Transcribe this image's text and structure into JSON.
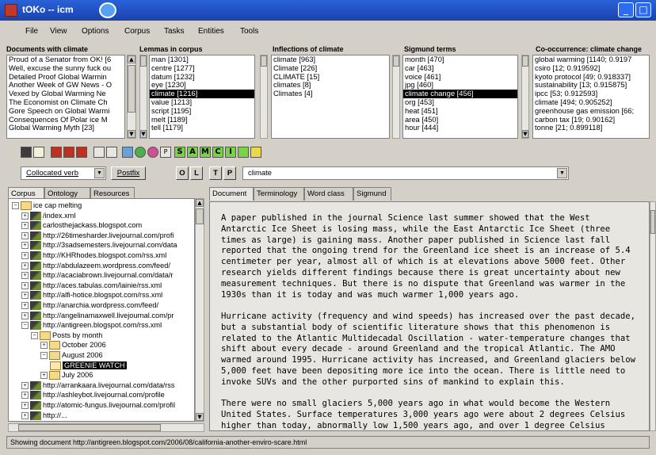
{
  "window": {
    "title": "tOKo -- icm"
  },
  "menu": [
    "File",
    "View",
    "Options",
    "Corpus",
    "Tasks",
    "Entities",
    "Tools"
  ],
  "panels": {
    "documents": {
      "title": "Documents with climate",
      "items": [
        "Proud of a Senator from OK! [6",
        "Well, excuse the sunny fuck ou",
        "Detailed Proof Global Warmin",
        "Another Week of GW News - O",
        "Vexed by Global Warming Ne",
        "The Economist on Climate Ch",
        "Gore Speech on Global Warmi",
        "Consequences Of Polar ice M",
        "Global Warming Myth [23]"
      ]
    },
    "lemmas": {
      "title": "Lemmas in corpus",
      "items": [
        "man [1301]",
        "centre [1277]",
        "datum [1232]",
        "eye [1230]",
        "climate [1216]",
        "value [1213]",
        "script [1195]",
        "melt [1189]",
        "tell [1179]"
      ],
      "selected": 4
    },
    "inflections": {
      "title": "Inflections of climate",
      "items": [
        "climate [963]",
        "Climate [226]",
        "CLIMATE [15]",
        "climates [8]",
        "Climates [4]"
      ]
    },
    "sigmund": {
      "title": "Sigmund terms",
      "items": [
        "month [470]",
        "car [463]",
        "voice [461]",
        "jpg [460]",
        "climate change [456]",
        "org [453]",
        "heat [451]",
        "area [450]",
        "hour [444]"
      ],
      "selected": 4
    },
    "cooccurrence": {
      "title": "Co-occurrence: climate change",
      "items": [
        "global warming [1140; 0.9197",
        "csiro [12; 0.919592]",
        "kyoto protocol [49; 0.918337]",
        "sustainability [13; 0.915875]",
        "ipcc [53; 0.912593]",
        "climate [494; 0.905252]",
        "greenhouse gas emission [66;",
        "carbon tax [19; 0.90162]",
        "tonne [21; 0.899118]"
      ]
    }
  },
  "toolbar": {
    "letters": [
      "P",
      "S",
      "A",
      "M",
      "C",
      "I"
    ]
  },
  "controls": {
    "collocated": "Collocated verb",
    "postfix": "Postfix",
    "o": "O",
    "l": "L",
    "t": "T",
    "p": "P",
    "search_value": "climate"
  },
  "left_tabs": [
    "Corpus",
    "Ontology",
    "Resources"
  ],
  "right_tabs": [
    "Document",
    "Terminology",
    "Word class",
    "Sigmund"
  ],
  "tree": [
    {
      "label": "ice cap melting",
      "indent": 0,
      "glyph": "−",
      "icon": "folder"
    },
    {
      "label": "/index.xml",
      "indent": 1,
      "glyph": "+",
      "icon": "feed"
    },
    {
      "label": "carlosthejackass.blogspot.com",
      "indent": 1,
      "glyph": "+",
      "icon": "feed"
    },
    {
      "label": "http://26timesharder.livejournal.com/profi",
      "indent": 1,
      "glyph": "+",
      "icon": "feed"
    },
    {
      "label": "http://3sadsemesters.livejournal.com/data",
      "indent": 1,
      "glyph": "+",
      "icon": "feed"
    },
    {
      "label": "http://KHRhodes.blogspot.com/rss.xml",
      "indent": 1,
      "glyph": "+",
      "icon": "feed"
    },
    {
      "label": "http://abdulazeem.wordpress.com/feed/",
      "indent": 1,
      "glyph": "+",
      "icon": "feed"
    },
    {
      "label": "http://acaciabrown.livejournal.com/data/r",
      "indent": 1,
      "glyph": "+",
      "icon": "feed"
    },
    {
      "label": "http://aces.tabulas.com/lainie/rss.xml",
      "indent": 1,
      "glyph": "+",
      "icon": "feed"
    },
    {
      "label": "http://alfi-hotice.blogspot.com/rss.xml",
      "indent": 1,
      "glyph": "+",
      "icon": "feed"
    },
    {
      "label": "http://anarchia.wordpress.com/feed/",
      "indent": 1,
      "glyph": "+",
      "icon": "feed"
    },
    {
      "label": "http://angelinamaxwell.livejournal.com/pr",
      "indent": 1,
      "glyph": "+",
      "icon": "feed"
    },
    {
      "label": "http://antigreen.blogspot.com/rss.xml",
      "indent": 1,
      "glyph": "−",
      "icon": "feed"
    },
    {
      "label": "Posts by month",
      "indent": 2,
      "glyph": "−",
      "icon": "folder"
    },
    {
      "label": "October 2006",
      "indent": 3,
      "glyph": "+",
      "icon": "folder"
    },
    {
      "label": "August 2006",
      "indent": 3,
      "glyph": "−",
      "icon": "folder"
    },
    {
      "label": "GREENIE WATCH",
      "indent": 4,
      "glyph": "",
      "icon": "mail",
      "selected": true
    },
    {
      "label": "July 2006",
      "indent": 3,
      "glyph": "+",
      "icon": "folder"
    },
    {
      "label": "http://arrankaara.livejournal.com/data/rss",
      "indent": 1,
      "glyph": "+",
      "icon": "feed"
    },
    {
      "label": "http://ashleybot.livejournal.com/profile",
      "indent": 1,
      "glyph": "+",
      "icon": "feed"
    },
    {
      "label": "http://atomic-fungus.livejournal.com/profil",
      "indent": 1,
      "glyph": "+",
      "icon": "feed"
    },
    {
      "label": "http://...",
      "indent": 1,
      "glyph": "+",
      "icon": "feed"
    }
  ],
  "document": {
    "paragraphs": [
      "A paper published in the journal Science last summer showed that the West\nAntarctic Ice Sheet is losing mass, while the East Antarctic Ice Sheet (three\ntimes as large) is gaining mass. Another paper published in Science last fall\nreported that the ongoing trend for the Greenland ice sheet is an increase of 5.4\ncentimeter per year, almost all of which is at elevations above 5000 feet. Other\nresearch yields different findings because there is great uncertainty about new\nmeasurement techniques. But there is no dispute that Greenland was warmer in the\n1930s than it is today and was much warmer 1,000 years ago.",
      "Hurricane activity (frequency and wind speeds) has increased over the past decade,\nbut a substantial body of scientific literature shows that this phenomenon is\nrelated to the Atlantic Multidecadal Oscillation - water-temperature changes that\nshift about every decade - around Greenland and the tropical Atlantic. The AMO\nwarmed around 1995. Hurricane activity has increased, and Greenland glaciers below\n5,000 feet have been depositing more ice into the ocean. There is little need to\ninvoke SUVs and the other purported sins of mankind to explain this.",
      "There were no small glaciers 5,000 years ago in what would become the Western\nUnited States. Surface temperatures 3,000 years ago were about 2 degrees Celsius\nhigher than today, abnormally low 1,500 years ago, and over 1 degree Celsius"
    ]
  },
  "status": "Showing document http://antigreen.blogspot.com/2006/08/california-another-enviro-scare.html"
}
